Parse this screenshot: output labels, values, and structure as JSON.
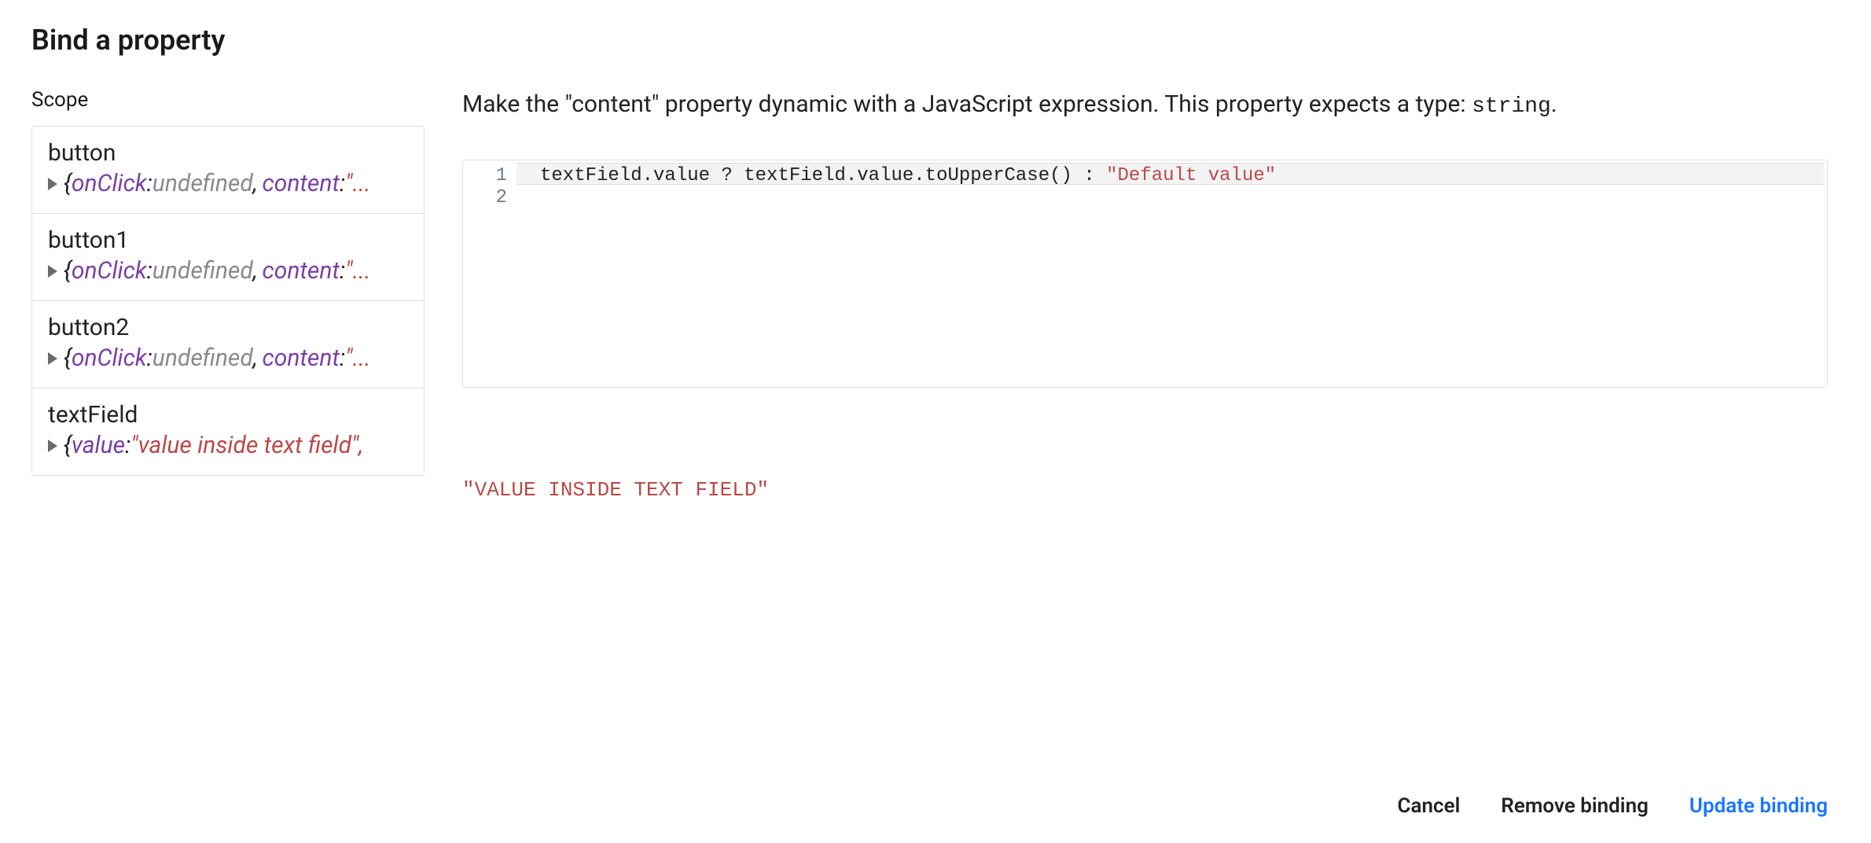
{
  "title": "Bind a property",
  "scope": {
    "label": "Scope",
    "items": [
      {
        "name": "button",
        "props": [
          {
            "key": "onClick",
            "type": "undef",
            "val": "undefined"
          },
          {
            "key": "content",
            "type": "str",
            "val": "\"..."
          }
        ]
      },
      {
        "name": "button1",
        "props": [
          {
            "key": "onClick",
            "type": "undef",
            "val": "undefined"
          },
          {
            "key": "content",
            "type": "str",
            "val": "\"..."
          }
        ]
      },
      {
        "name": "button2",
        "props": [
          {
            "key": "onClick",
            "type": "undef",
            "val": "undefined"
          },
          {
            "key": "content",
            "type": "str",
            "val": "\"..."
          }
        ]
      },
      {
        "name": "textField",
        "props": [
          {
            "key": "value",
            "type": "str",
            "val": "\"value inside text field\","
          }
        ]
      }
    ]
  },
  "instruction": {
    "prefix": "Make the \"content\" property dynamic with a JavaScript expression. This property expects a type: ",
    "type_code": "string",
    "suffix": "."
  },
  "editor": {
    "lines": [
      "1",
      "2"
    ],
    "code_tokens": [
      {
        "t": "textField.value ? textField.value.toUpperCase() : ",
        "c": "tok-default"
      },
      {
        "t": "\"Default value\"",
        "c": "tok-str"
      }
    ]
  },
  "result": "\"VALUE INSIDE TEXT FIELD\"",
  "footer": {
    "cancel": "Cancel",
    "remove": "Remove binding",
    "update": "Update binding"
  }
}
